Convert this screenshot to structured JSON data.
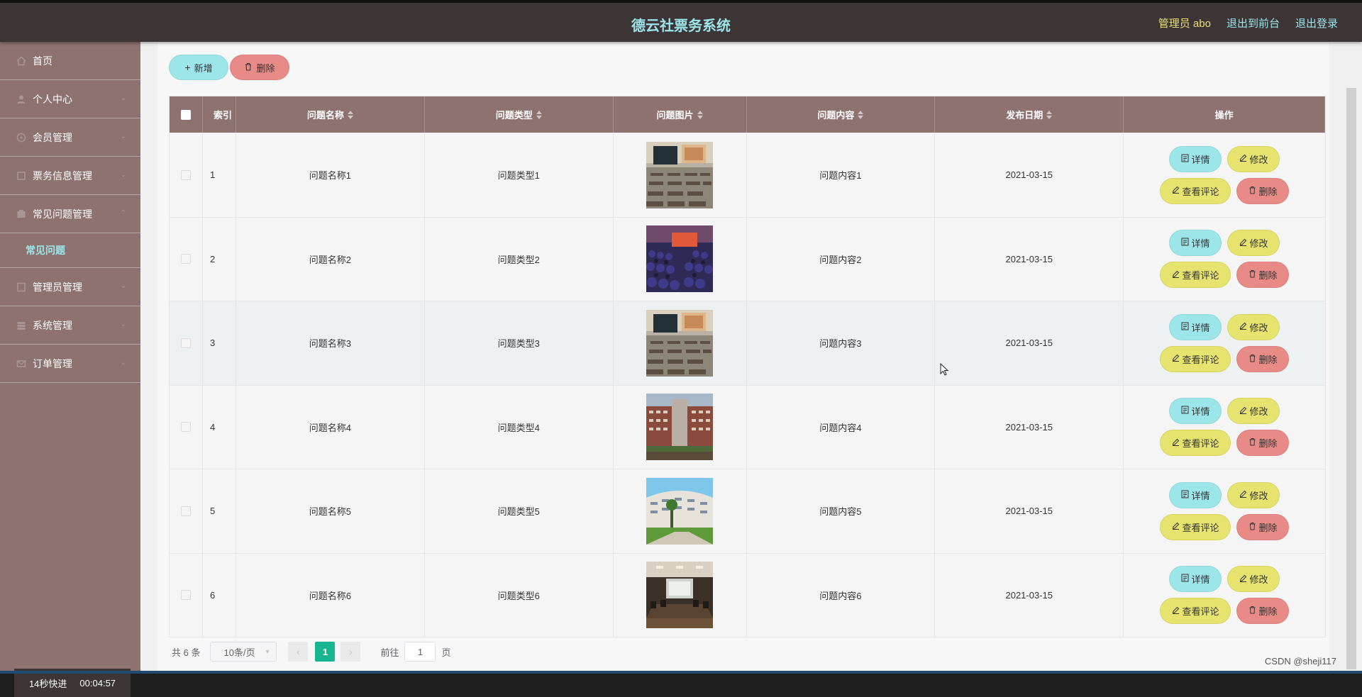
{
  "header": {
    "title": "德云社票务系统",
    "admin_label": "管理员 abo",
    "front_link": "退出到前台",
    "logout_link": "退出登录"
  },
  "sidebar": {
    "items": [
      {
        "label": "首页",
        "icon": "home-icon"
      },
      {
        "label": "个人中心",
        "icon": "user-icon"
      },
      {
        "label": "会员管理",
        "icon": "member-icon"
      },
      {
        "label": "票务信息管理",
        "icon": "ticket-icon"
      },
      {
        "label": "常见问题管理",
        "icon": "faq-icon"
      },
      {
        "label": "管理员管理",
        "icon": "admin-icon"
      },
      {
        "label": "系统管理",
        "icon": "system-icon"
      },
      {
        "label": "订单管理",
        "icon": "order-icon"
      }
    ],
    "active_sub": "常见问题"
  },
  "video_badge": {
    "label": "14秒快进",
    "time": "00:04:57"
  },
  "toolbar": {
    "add_label": "新增",
    "delete_label": "删除"
  },
  "table": {
    "headers": {
      "index": "索引",
      "name": "问题名称",
      "type": "问题类型",
      "image": "问题图片",
      "content": "问题内容",
      "date": "发布日期",
      "ops": "操作"
    },
    "rows": [
      {
        "index": "1",
        "name": "问题名称1",
        "type": "问题类型1",
        "content": "问题内容1",
        "date": "2021-03-15",
        "image": "classroom"
      },
      {
        "index": "2",
        "name": "问题名称2",
        "type": "问题类型2",
        "content": "问题内容2",
        "date": "2021-03-15",
        "image": "auditorium"
      },
      {
        "index": "3",
        "name": "问题名称3",
        "type": "问题类型3",
        "content": "问题内容3",
        "date": "2021-03-15",
        "image": "classroom"
      },
      {
        "index": "4",
        "name": "问题名称4",
        "type": "问题类型4",
        "content": "问题内容4",
        "date": "2021-03-15",
        "image": "building"
      },
      {
        "index": "5",
        "name": "问题名称5",
        "type": "问题类型5",
        "content": "问题内容5",
        "date": "2021-03-15",
        "image": "campus"
      },
      {
        "index": "6",
        "name": "问题名称6",
        "type": "问题类型6",
        "content": "问题内容6",
        "date": "2021-03-15",
        "image": "meeting-room"
      }
    ],
    "op_labels": {
      "detail": "详情",
      "edit": "修改",
      "view_comments": "查看评论",
      "delete": "删除"
    }
  },
  "pagination": {
    "total": "共 6 条",
    "page_size": "10条/页",
    "current_page": "1",
    "goto_label": "前往",
    "goto_value": "1",
    "page_suffix": "页"
  },
  "watermark": "CSDN @sheji117",
  "colors": {
    "header_bg": "#3d3435",
    "title": "#9ce6ea",
    "admin": "#e6e07a",
    "sidebar_bg": "#8d7270",
    "primary_btn": "#9ce6ea",
    "danger_btn": "#e88a86",
    "warning_btn": "#e6e36e",
    "active_page": "#19b492"
  }
}
